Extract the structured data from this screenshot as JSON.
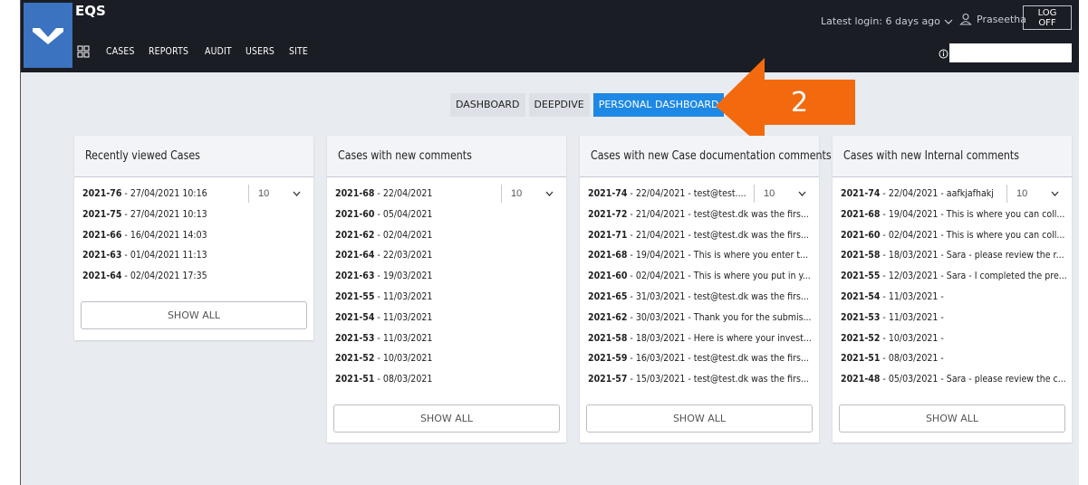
{
  "app": {
    "title": "EQS"
  },
  "nav": [
    "CASES",
    "REPORTS",
    "AUDIT",
    "USERS",
    "SITE"
  ],
  "header": {
    "latest_login": "Latest login: 6 days ago",
    "user": "Praseetha",
    "logoff": "LOG OFF",
    "search_value": ""
  },
  "tabs": [
    {
      "label": "DASHBOARD",
      "active": false
    },
    {
      "label": "DEEPDIVE",
      "active": false
    },
    {
      "label": "PERSONAL DASHBOARD",
      "active": true
    }
  ],
  "annotation": {
    "number": "2",
    "color": "#f26a0d"
  },
  "accent": "#1e88e5",
  "cards": [
    {
      "title": "Recently viewed Cases",
      "select_value": "10",
      "show_all": "SHOW ALL",
      "rows": [
        {
          "id": "2021-76",
          "text": " - 27/04/2021 10:16"
        },
        {
          "id": "2021-75",
          "text": " - 27/04/2021 10:13"
        },
        {
          "id": "2021-66",
          "text": " - 16/04/2021 14:03"
        },
        {
          "id": "2021-63",
          "text": " - 01/04/2021 11:13"
        },
        {
          "id": "2021-64",
          "text": " - 02/04/2021 17:35"
        }
      ]
    },
    {
      "title": "Cases with new comments",
      "select_value": "10",
      "show_all": "SHOW ALL",
      "rows": [
        {
          "id": "2021-68",
          "text": " - 22/04/2021"
        },
        {
          "id": "2021-60",
          "text": " - 05/04/2021"
        },
        {
          "id": "2021-62",
          "text": " - 02/04/2021"
        },
        {
          "id": "2021-64",
          "text": " - 22/03/2021"
        },
        {
          "id": "2021-63",
          "text": " - 19/03/2021"
        },
        {
          "id": "2021-55",
          "text": " - 11/03/2021"
        },
        {
          "id": "2021-54",
          "text": " - 11/03/2021"
        },
        {
          "id": "2021-53",
          "text": " - 11/03/2021"
        },
        {
          "id": "2021-52",
          "text": " - 10/03/2021"
        },
        {
          "id": "2021-51",
          "text": " - 08/03/2021"
        }
      ]
    },
    {
      "title": "Cases with new Case documentation comments",
      "select_value": "10",
      "show_all": "SHOW ALL",
      "rows": [
        {
          "id": "2021-74",
          "text": " - 22/04/2021 - test@test...."
        },
        {
          "id": "2021-72",
          "text": " - 21/04/2021 - test@test.dk was the firs..."
        },
        {
          "id": "2021-71",
          "text": " - 21/04/2021 - test@test.dk was the firs..."
        },
        {
          "id": "2021-68",
          "text": " - 19/04/2021 - This is where you enter t..."
        },
        {
          "id": "2021-60",
          "text": " - 02/04/2021 - This is where you put in y..."
        },
        {
          "id": "2021-65",
          "text": " - 31/03/2021 - test@test.dk was the firs..."
        },
        {
          "id": "2021-62",
          "text": " - 30/03/2021 - Thank you for the submis..."
        },
        {
          "id": "2021-58",
          "text": " - 18/03/2021 - Here is where your invest..."
        },
        {
          "id": "2021-59",
          "text": " - 16/03/2021 - test@test.dk was the firs..."
        },
        {
          "id": "2021-57",
          "text": " - 15/03/2021 - test@test.dk was the firs..."
        }
      ]
    },
    {
      "title": "Cases with new Internal comments",
      "select_value": "10",
      "show_all": "SHOW ALL",
      "rows": [
        {
          "id": "2021-74",
          "text": " - 22/04/2021 - aafkjafhakj"
        },
        {
          "id": "2021-68",
          "text": " - 19/04/2021 - This is where you can coll..."
        },
        {
          "id": "2021-60",
          "text": " - 02/04/2021 - This is where you can coll..."
        },
        {
          "id": "2021-58",
          "text": " - 18/03/2021 - Sara - please review the r..."
        },
        {
          "id": "2021-55",
          "text": " - 12/03/2021 - Sara - I completed the pre..."
        },
        {
          "id": "2021-54",
          "text": " - 11/03/2021 -"
        },
        {
          "id": "2021-53",
          "text": " - 11/03/2021 -"
        },
        {
          "id": "2021-52",
          "text": " - 10/03/2021 -"
        },
        {
          "id": "2021-51",
          "text": " - 08/03/2021 -"
        },
        {
          "id": "2021-48",
          "text": " - 05/03/2021 - Sara - please review the c..."
        }
      ]
    }
  ]
}
